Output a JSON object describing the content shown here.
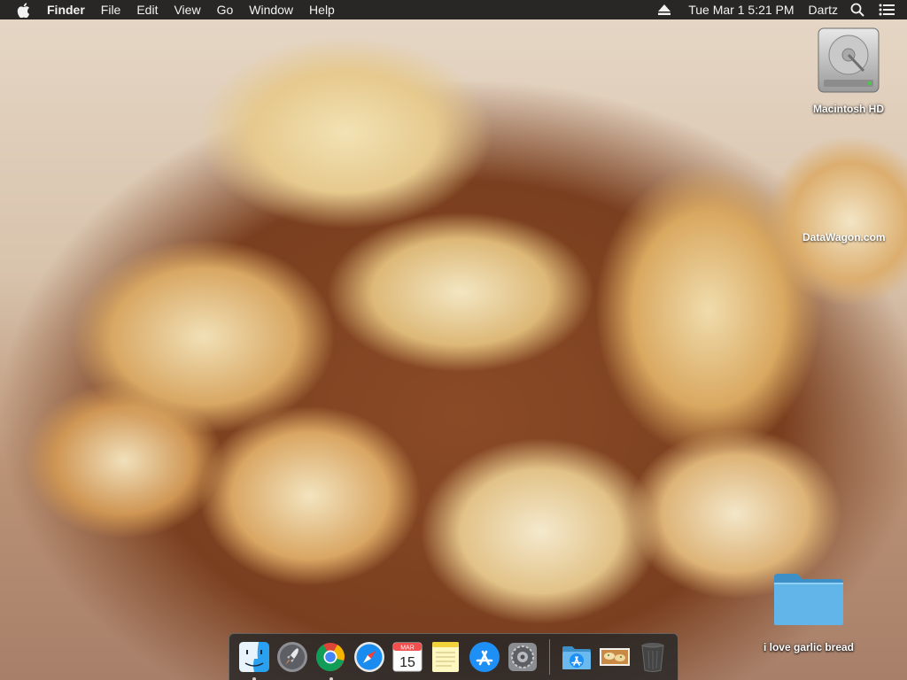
{
  "menubar": {
    "apple_icon": "apple-icon",
    "app_name": "Finder",
    "menus": [
      "File",
      "Edit",
      "View",
      "Go",
      "Window",
      "Help"
    ],
    "clock": "Tue Mar 1 5:21 PM",
    "user": "Dartz",
    "icons": [
      "eject-icon",
      "spotlight-search-icon",
      "notification-center-icon"
    ]
  },
  "desktop": {
    "hard_drive_label": "Macintosh HD",
    "folder_label": "i love garlic bread",
    "wallpaper_watermark": "DataWagon.com"
  },
  "dock": {
    "items": [
      {
        "name": "Finder",
        "icon": "finder-icon",
        "running": true
      },
      {
        "name": "Launchpad",
        "icon": "launchpad-icon",
        "running": false
      },
      {
        "name": "Google Chrome",
        "icon": "chrome-icon",
        "running": true
      },
      {
        "name": "Safari",
        "icon": "safari-icon",
        "running": false
      },
      {
        "name": "Calendar",
        "icon": "calendar-icon",
        "running": false,
        "month": "MAR",
        "day": "15"
      },
      {
        "name": "Notes",
        "icon": "notes-icon",
        "running": false
      },
      {
        "name": "App Store",
        "icon": "app-store-icon",
        "running": false
      },
      {
        "name": "System Preferences",
        "icon": "system-preferences-icon",
        "running": false
      },
      {
        "name": "Applications",
        "icon": "applications-folder-icon",
        "running": false
      },
      {
        "name": "Image",
        "icon": "image-thumbnail-icon",
        "running": false
      },
      {
        "name": "Trash",
        "icon": "trash-icon",
        "running": false
      }
    ]
  },
  "colors": {
    "menubar_bg": "#181818",
    "folder_blue": "#5aaee0",
    "dock_bg": "#282828"
  }
}
